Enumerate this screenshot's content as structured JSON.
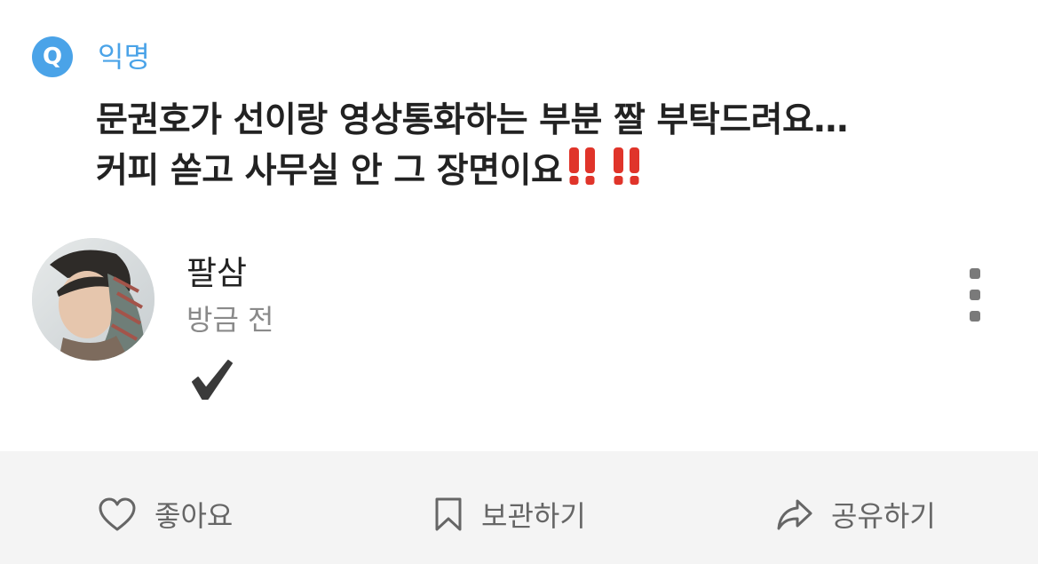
{
  "question": {
    "badge": "Q",
    "author_type": "익명",
    "line1": "문권호가 선이랑 영상통화하는 부분 짤 부탁드려요…",
    "line2": "커피 쏟고 사무실 안 그 장면이요",
    "emphasis_icon": "double-exclamation-icon",
    "emphasis_color": "#e0342a"
  },
  "answer": {
    "author": "팔삼",
    "time": "방금 전",
    "mark_icon": "checkmark-icon"
  },
  "actions": {
    "like_label": "좋아요",
    "save_label": "보관하기",
    "share_label": "공유하기"
  },
  "colors": {
    "accent": "#4aa3e8",
    "text": "#222222",
    "muted": "#8a8a8a",
    "action_bar_bg": "#f4f4f4"
  }
}
